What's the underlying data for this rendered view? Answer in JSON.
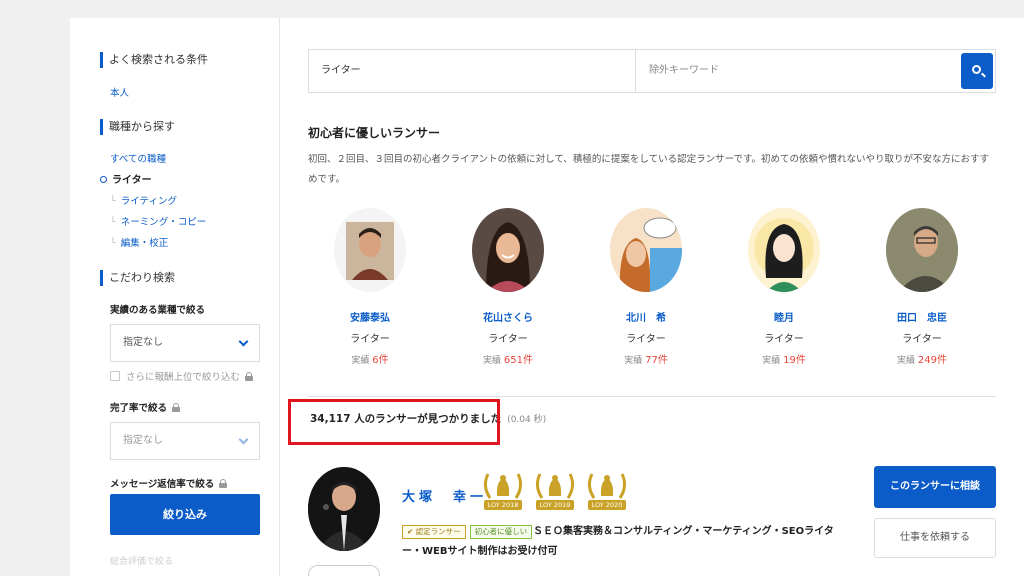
{
  "sidebar": {
    "frequent_heading": "よく検索される条件",
    "frequent_link": "本人",
    "job_heading": "職種から探す",
    "all_jobs": "すべての職種",
    "current_category": "ライター",
    "subcategories": [
      "ライティング",
      "ネーミング・コピー",
      "編集・校正"
    ],
    "advanced_heading": "こだわり検索",
    "industry_label": "実績のある業種で絞る",
    "industry_value": "指定なし",
    "reward_checkbox": "さらに報酬上位で絞り込む",
    "completion_label": "完了率で絞る",
    "completion_value": "指定なし",
    "message_label": "メッセージ返信率で絞る",
    "narrow_button": "絞り込み",
    "faded_label": "総合評価で絞る"
  },
  "search": {
    "keyword_value": "ライター",
    "exclude_placeholder": "除外キーワード"
  },
  "beginner": {
    "title": "初心者に優しいランサー",
    "description": "初回、２回目、３回目の初心者クライアントの依頼に対して、積極的に提案をしている認定ランサーです。初めての依頼や慣れないやり取りが不安な方におすすめです。",
    "record_prefix": "実績",
    "record_suffix": "件",
    "lancers": [
      {
        "name": "安藤泰弘",
        "role": "ライター",
        "count": "6"
      },
      {
        "name": "花山さくら",
        "role": "ライター",
        "count": "651"
      },
      {
        "name": "北川　希",
        "role": "ライター",
        "count": "77"
      },
      {
        "name": "睦月",
        "role": "ライター",
        "count": "19"
      },
      {
        "name": "田口　忠臣",
        "role": "ライター",
        "count": "249"
      }
    ]
  },
  "results": {
    "count_text": "34,117 人のランサーが見つかりました",
    "time_text": "(0.04 秒)"
  },
  "first_lancer": {
    "name": "大塚　幸一",
    "badges": [
      "LOY 2018",
      "LOY 2019",
      "LOY 2020"
    ],
    "tag_certified": "認定ランサー",
    "tag_beginner": "初心者に優しい",
    "catchphrase": "ＳＥＯ集客実務＆コンサルティング・マーケティング・SEOライター・WEBサイト制作はお受け付可",
    "consult_button": "このランサーに相談",
    "request_button": "仕事を依頼する"
  },
  "colors": {
    "accent": "#0b5cc8",
    "record": "#e8473b",
    "highlight": "#e0141e",
    "badge_gold": "#c9a227"
  }
}
